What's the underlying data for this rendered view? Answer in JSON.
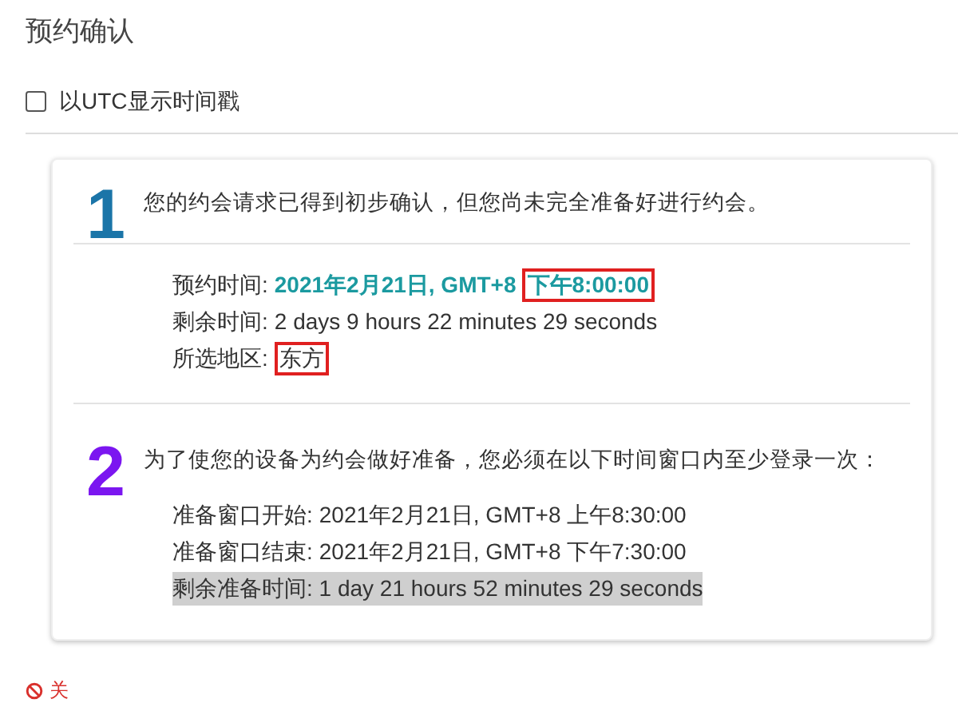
{
  "title": "预约确认",
  "utc_toggle": {
    "label": "以UTC显示时间戳",
    "checked": false
  },
  "steps": [
    {
      "number": "1",
      "color": "#1b75a8",
      "message": "您的约会请求已得到初步确认，但您尚未完全准备好进行约会。",
      "divider": true,
      "details": [
        {
          "label": "预约时间:",
          "value": "2021年2月21日, GMT+8",
          "boxed_value": "下午8:00:00",
          "emphasis": true,
          "highlighted": false
        },
        {
          "label": "剩余时间:",
          "value": "2 days 9 hours 22 minutes 29 seconds",
          "emphasis": false,
          "highlighted": false
        },
        {
          "label": "所选地区:",
          "boxed_value": "东方",
          "emphasis": false,
          "highlighted": false
        }
      ]
    },
    {
      "number": "2",
      "color": "#7b16f0",
      "message": "为了使您的设备为约会做好准备，您必须在以下时间窗口内至少登录一次：",
      "divider": false,
      "details": [
        {
          "label": "准备窗口开始:",
          "value": "2021年2月21日, GMT+8 上午8:30:00",
          "emphasis": false,
          "highlighted": false
        },
        {
          "label": "准备窗口结束:",
          "value": "2021年2月21日, GMT+8 下午7:30:00",
          "emphasis": false,
          "highlighted": false
        },
        {
          "label": "剩余准备时间:",
          "value": "1 day 21 hours 52 minutes 29 seconds",
          "emphasis": false,
          "highlighted": true
        }
      ]
    }
  ],
  "close_link": {
    "label": "关"
  }
}
